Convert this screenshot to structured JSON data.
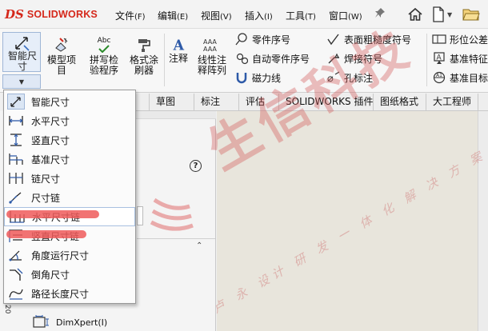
{
  "app": {
    "brand_ds": "DS",
    "brand_name": "SOLIDWORKS"
  },
  "menubar": {
    "items": [
      {
        "label": "文件",
        "key": "(F)"
      },
      {
        "label": "编辑",
        "key": "(E)"
      },
      {
        "label": "视图",
        "key": "(V)"
      },
      {
        "label": "插入",
        "key": "(I)"
      },
      {
        "label": "工具",
        "key": "(T)"
      },
      {
        "label": "窗口",
        "key": "(W)"
      }
    ],
    "icons": [
      "pin-icon",
      "home-icon",
      "new-document-icon",
      "open-folder-icon"
    ]
  },
  "ribbon": {
    "smart_dimension": "智能尺寸",
    "model_items": "模型项目",
    "spell_check": "拼写检验程序",
    "format_painter": "格式涂刷器",
    "note": "注释",
    "linear_note_pattern": "线性注释阵列",
    "balloon": "零件序号",
    "auto_balloon": "自动零件序号",
    "magnetic_line": "磁力线",
    "surface_finish": "表面粗糙度符号",
    "weld_symbol": "焊接符号",
    "hole_callout": "孔标注",
    "gtol": "形位公差",
    "datum_feature": "基准特征",
    "datum_target": "基准目标",
    "abc_label": "Abc"
  },
  "tabs": [
    "草图",
    "标注",
    "评估",
    "SOLIDWORKS 插件",
    "图纸格式",
    "大工程师"
  ],
  "dropdown": {
    "items": [
      {
        "label": "智能尺寸",
        "icon": "smart-dimension-icon"
      },
      {
        "label": "水平尺寸",
        "icon": "horizontal-dimension-icon"
      },
      {
        "label": "竖直尺寸",
        "icon": "vertical-dimension-icon"
      },
      {
        "label": "基准尺寸",
        "icon": "baseline-dimension-icon"
      },
      {
        "label": "链尺寸",
        "icon": "chain-dimension-icon"
      },
      {
        "label": "尺寸链",
        "icon": "ordinate-dimension-icon"
      },
      {
        "label": "水平尺寸链",
        "icon": "horizontal-ordinate-icon"
      },
      {
        "label": "竖直尺寸链",
        "icon": "vertical-ordinate-icon"
      },
      {
        "label": "角度运行尺寸",
        "icon": "angular-running-icon"
      },
      {
        "label": "倒角尺寸",
        "icon": "chamfer-dimension-icon"
      },
      {
        "label": "路径长度尺寸",
        "icon": "path-length-icon"
      }
    ],
    "hovered_index": 6,
    "highlight_color": "#ee5a5a"
  },
  "panel": {
    "help": "?",
    "side_number": "20",
    "dimxpert": "DimXpert(I)"
  },
  "watermark": {
    "main": "生信科技",
    "sub": "卢 永 设计 研 发 一 体 化 解 决 方 案"
  },
  "colors": {
    "brand": "#d5281b",
    "canvas": "#e8e5dc"
  }
}
